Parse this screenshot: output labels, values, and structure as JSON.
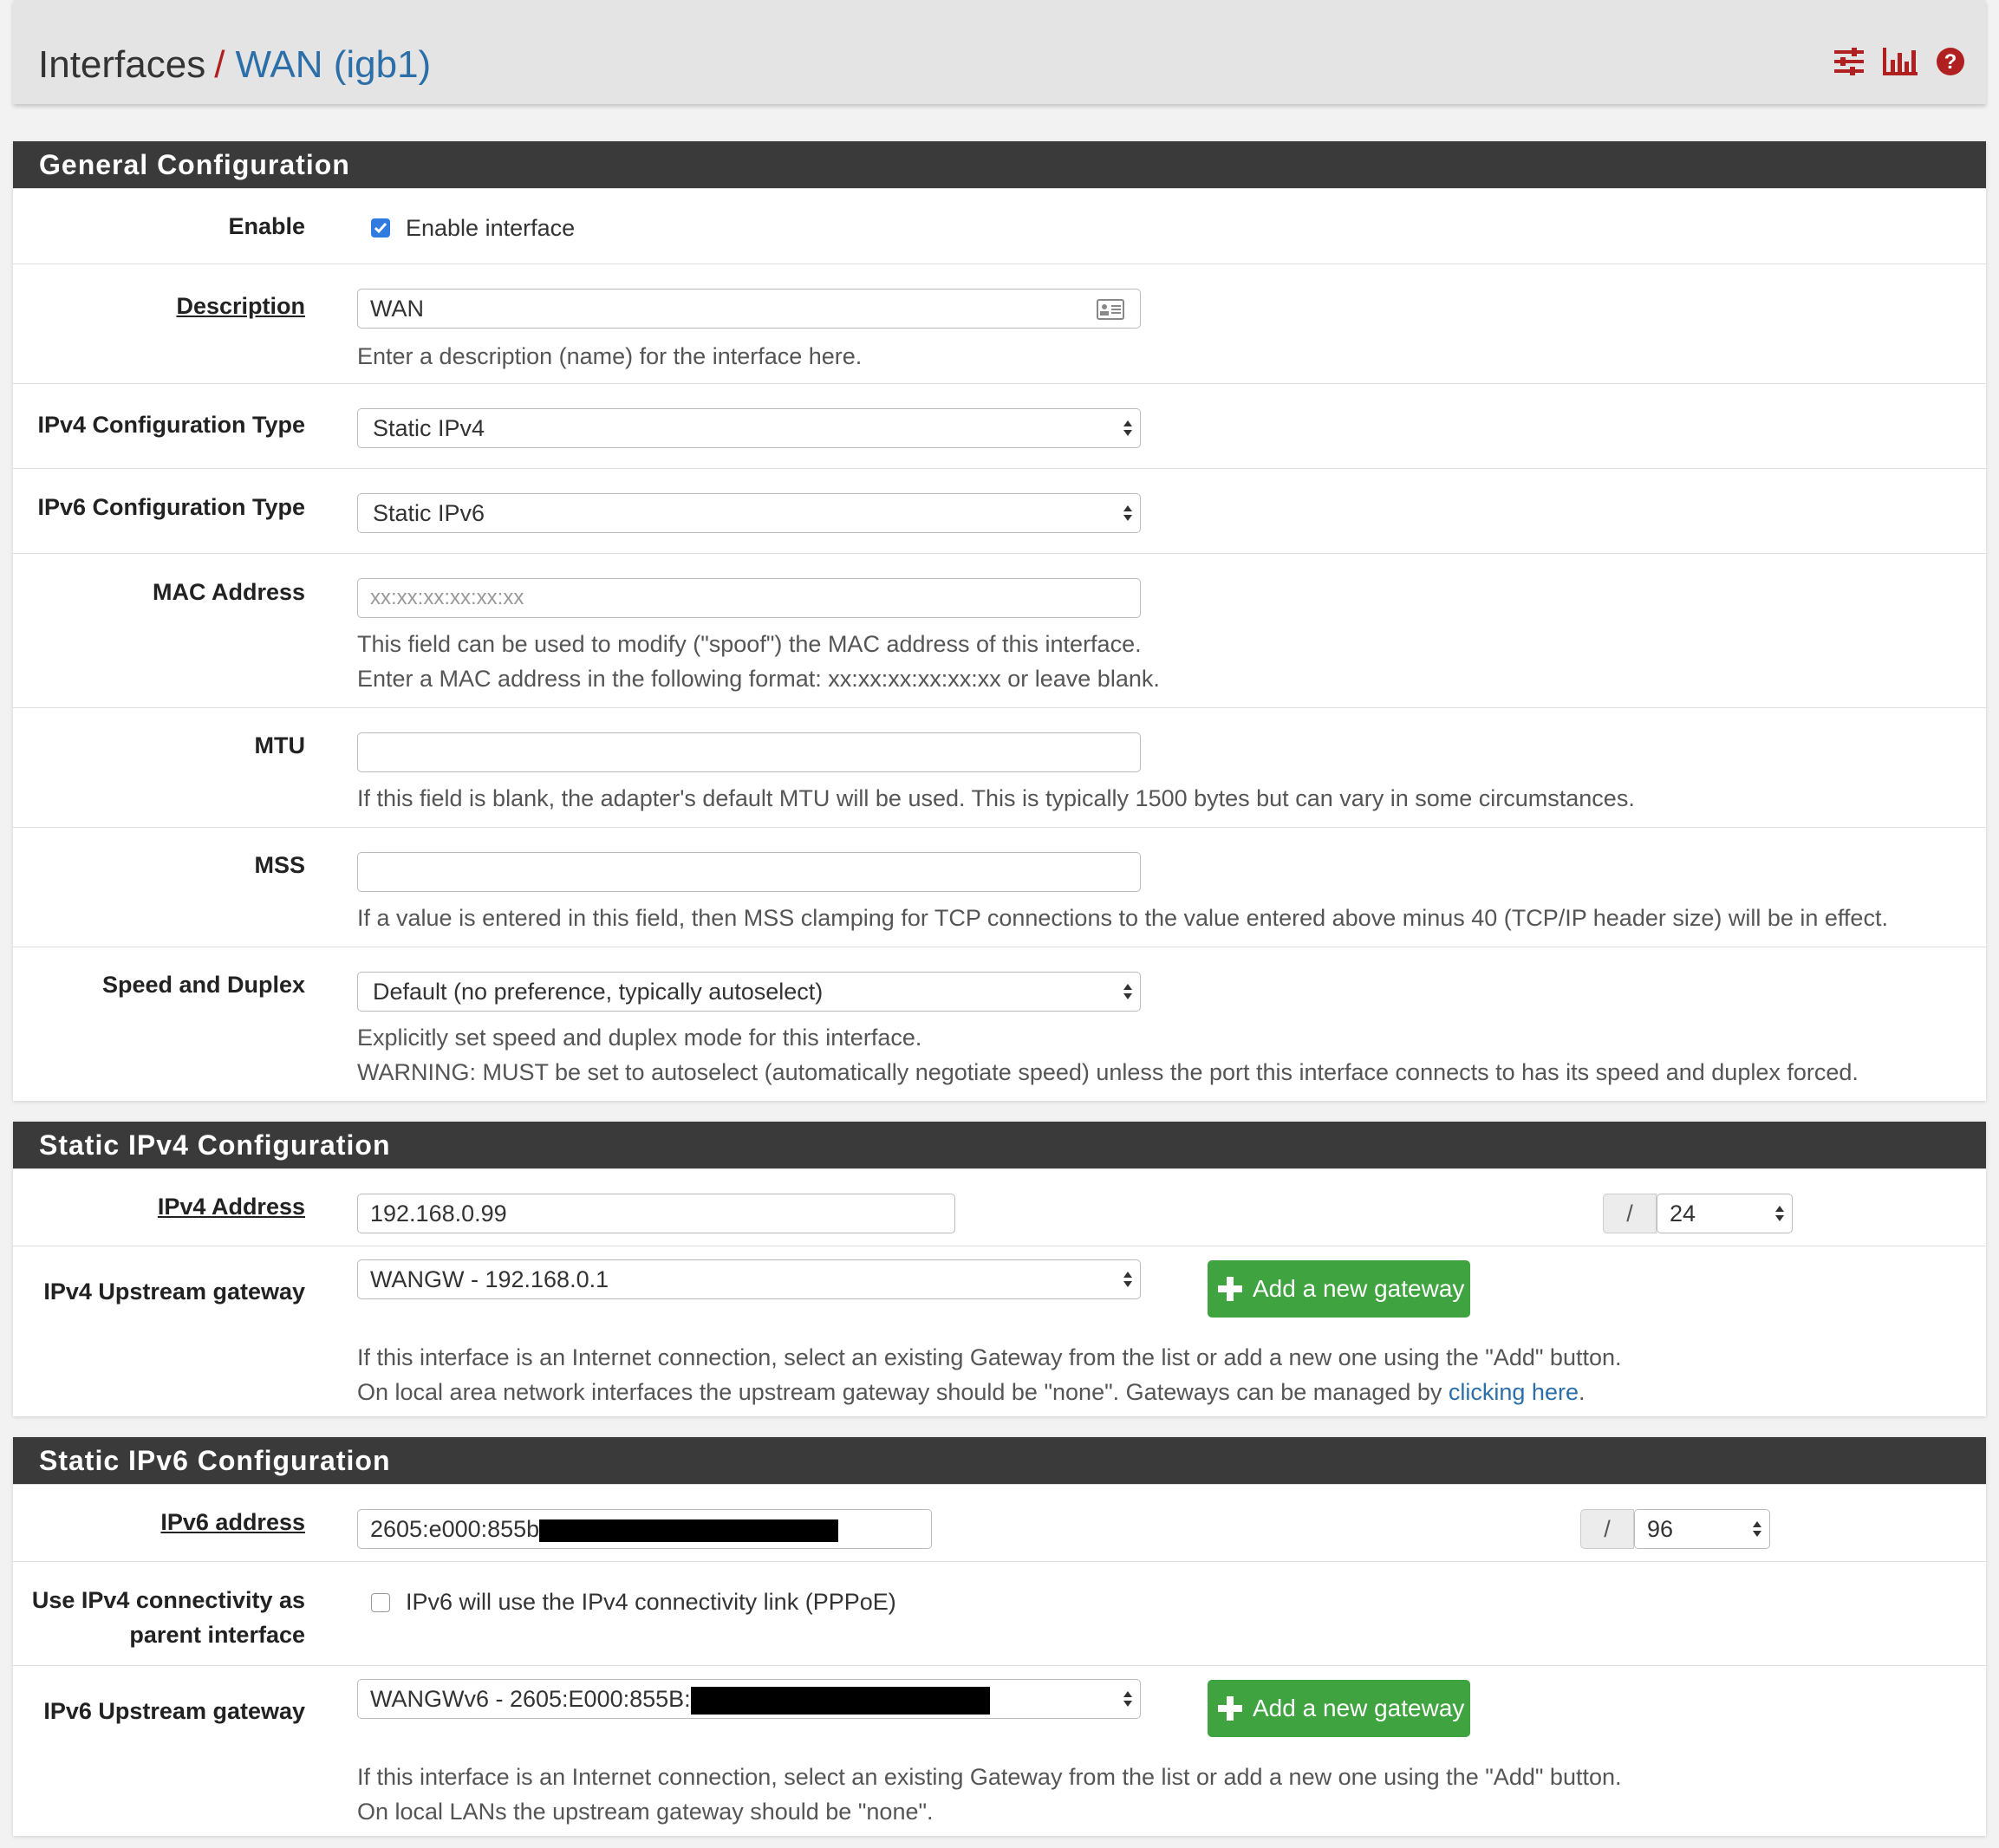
{
  "breadcrumb": {
    "root": "Interfaces",
    "separator": "/",
    "current": "WAN (igb1)"
  },
  "header_icons": [
    "sliders-icon",
    "bar-chart-icon",
    "help-icon"
  ],
  "colors": {
    "accent_red": "#b02020",
    "link_blue": "#2c6fa8",
    "panel_header": "#3a3a3a",
    "button_green": "#3fa33f",
    "checkbox_blue": "#2f7be0"
  },
  "general": {
    "title": "General Configuration",
    "enable": {
      "label": "Enable",
      "checkbox_label": "Enable interface",
      "checked": true
    },
    "description": {
      "label": "Description",
      "value": "WAN",
      "help": "Enter a description (name) for the interface here."
    },
    "ipv4_type": {
      "label": "IPv4 Configuration Type",
      "value": "Static IPv4"
    },
    "ipv6_type": {
      "label": "IPv6 Configuration Type",
      "value": "Static IPv6"
    },
    "mac": {
      "label": "MAC Address",
      "placeholder": "xx:xx:xx:xx:xx:xx",
      "help1": "This field can be used to modify (\"spoof\") the MAC address of this interface.",
      "help2": "Enter a MAC address in the following format: xx:xx:xx:xx:xx:xx or leave blank."
    },
    "mtu": {
      "label": "MTU",
      "value": "",
      "help": "If this field is blank, the adapter's default MTU will be used. This is typically 1500 bytes but can vary in some circumstances."
    },
    "mss": {
      "label": "MSS",
      "value": "",
      "help": "If a value is entered in this field, then MSS clamping for TCP connections to the value entered above minus 40 (TCP/IP header size) will be in effect."
    },
    "speed": {
      "label": "Speed and Duplex",
      "value": "Default (no preference, typically autoselect)",
      "help1": "Explicitly set speed and duplex mode for this interface.",
      "help2": "WARNING: MUST be set to autoselect (automatically negotiate speed) unless the port this interface connects to has its speed and duplex forced."
    }
  },
  "ipv4": {
    "title": "Static IPv4 Configuration",
    "address": {
      "label": "IPv4 Address",
      "value": "192.168.0.99",
      "slash": "/",
      "prefix": "24"
    },
    "gateway": {
      "label": "IPv4 Upstream gateway",
      "value": "WANGW - 192.168.0.1",
      "button": "Add a new gateway",
      "help1": "If this interface is an Internet connection, select an existing Gateway from the list or add a new one using the \"Add\" button.",
      "help2_pre": "On local area network interfaces the upstream gateway should be \"none\". Gateways can be managed by ",
      "help2_link": "clicking here",
      "help2_post": "."
    }
  },
  "ipv6": {
    "title": "Static IPv6 Configuration",
    "address": {
      "label": "IPv6 address",
      "value": "2605:e000:855b",
      "slash": "/",
      "prefix": "96"
    },
    "parent": {
      "label_line1": "Use IPv4 connectivity as",
      "label_line2": "parent interface",
      "checkbox_label": "IPv6 will use the IPv4 connectivity link (PPPoE)",
      "checked": false
    },
    "gateway": {
      "label": "IPv6 Upstream gateway",
      "value": "WANGWv6 - 2605:E000:855B:",
      "button": "Add a new gateway",
      "help1": "If this interface is an Internet connection, select an existing Gateway from the list or add a new one using the \"Add\" button.",
      "help2": "On local LANs the upstream gateway should be \"none\"."
    }
  }
}
